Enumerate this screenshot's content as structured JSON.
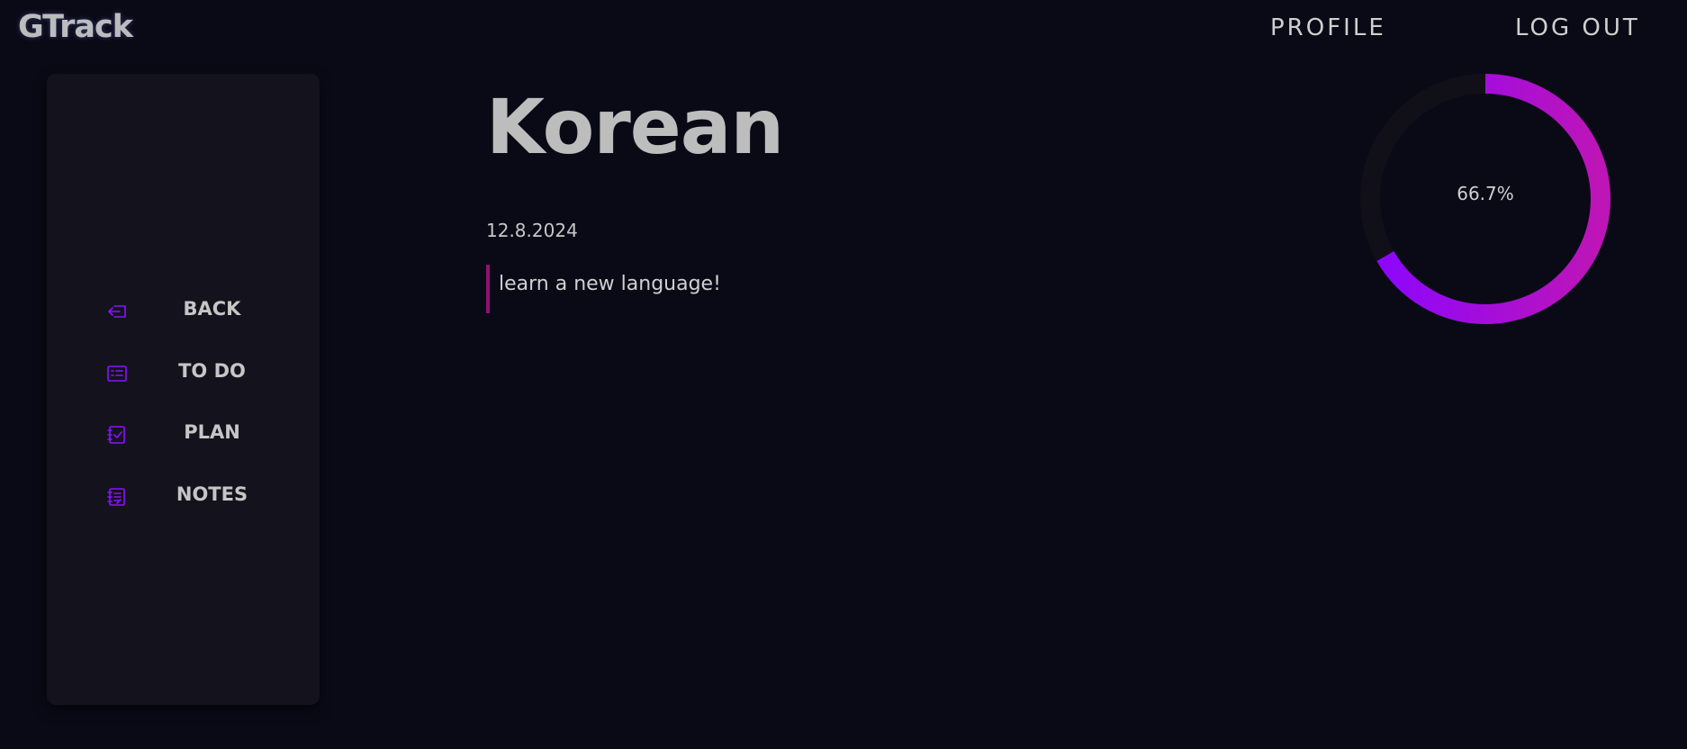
{
  "app": {
    "logo": "GTrack"
  },
  "header": {
    "profile": "PROFILE",
    "logout": "LOG OUT"
  },
  "sidebar": {
    "items": [
      {
        "label": "BACK",
        "icon": "back-arrow-icon"
      },
      {
        "label": "TO DO",
        "icon": "list-icon"
      },
      {
        "label": "PLAN",
        "icon": "checklist-icon"
      },
      {
        "label": "NOTES",
        "icon": "notes-icon"
      }
    ]
  },
  "goal": {
    "title": "Korean",
    "date": "12.8.2024",
    "description": "learn a new language!"
  },
  "progress": {
    "label": "66.7%",
    "fraction": 0.667,
    "gradient_start": "#8a06ff",
    "gradient_end": "#be15b6",
    "track_color": "#111018"
  },
  "colors": {
    "background": "#0a0a17",
    "sidebar": "#14131d",
    "icon": "#8a13ff",
    "note_border": "#8f1170"
  }
}
